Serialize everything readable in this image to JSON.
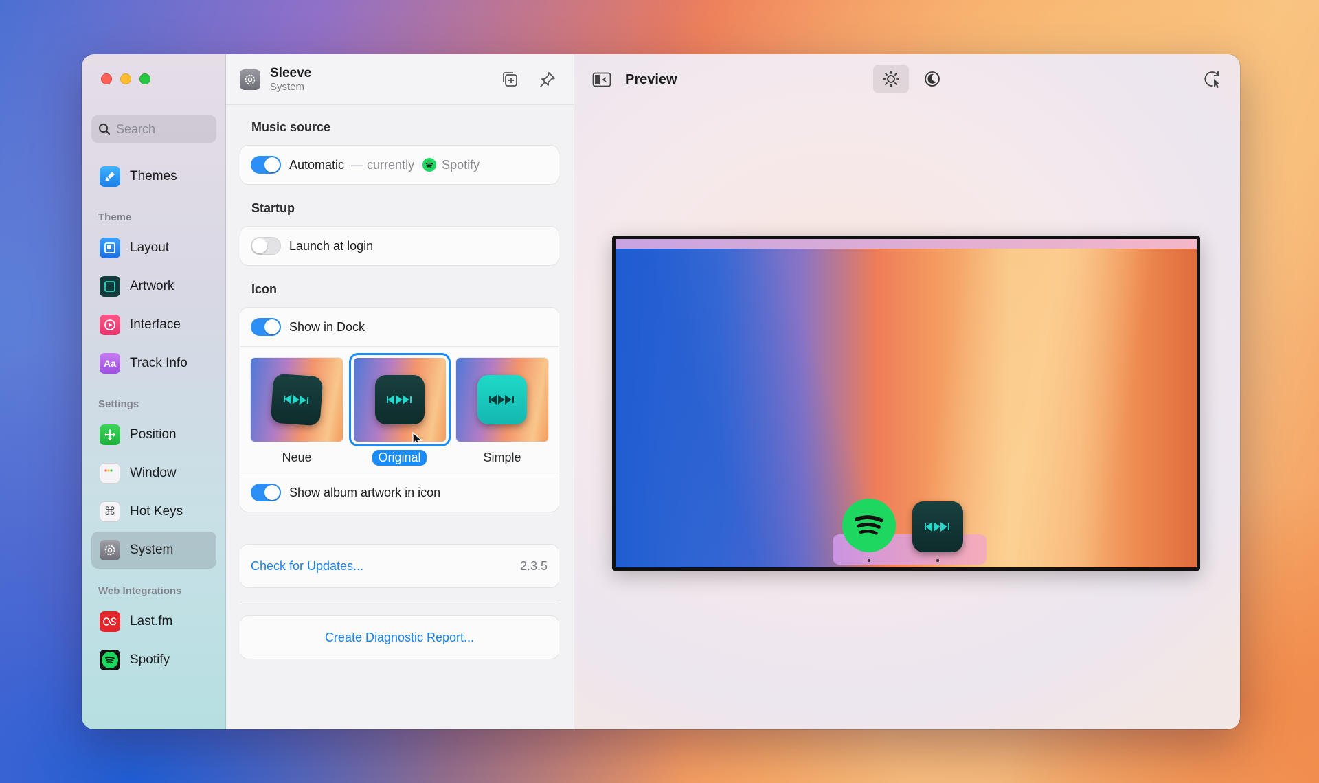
{
  "sidebar": {
    "search_placeholder": "Search",
    "themes_label": "Themes",
    "sections": {
      "theme": "Theme",
      "settings": "Settings",
      "web": "Web Integrations"
    },
    "theme_items": [
      "Layout",
      "Artwork",
      "Interface",
      "Track Info"
    ],
    "settings_items": [
      "Position",
      "Window",
      "Hot Keys",
      "System"
    ],
    "web_items": [
      "Last.fm",
      "Spotify"
    ],
    "active_item": "System"
  },
  "header": {
    "title": "Sleeve",
    "subtitle": "System"
  },
  "music_source": {
    "label": "Music source",
    "toggle_label": "Automatic",
    "currently": "— currently",
    "source": "Spotify",
    "enabled": true
  },
  "startup": {
    "label": "Startup",
    "launch_label": "Launch at login",
    "enabled": false
  },
  "icon": {
    "label": "Icon",
    "show_in_dock": "Show in Dock",
    "show_in_dock_enabled": true,
    "choices": [
      "Neue",
      "Original",
      "Simple"
    ],
    "selected": "Original",
    "album_art_label": "Show album artwork in icon",
    "album_art_enabled": true
  },
  "updates": {
    "link": "Check for Updates...",
    "version": "2.3.5"
  },
  "diagnostic": {
    "link": "Create Diagnostic Report..."
  },
  "preview": {
    "title": "Preview",
    "appearance": "light"
  },
  "colors": {
    "accent": "#1a8cf5",
    "spotify": "#1ed760"
  }
}
